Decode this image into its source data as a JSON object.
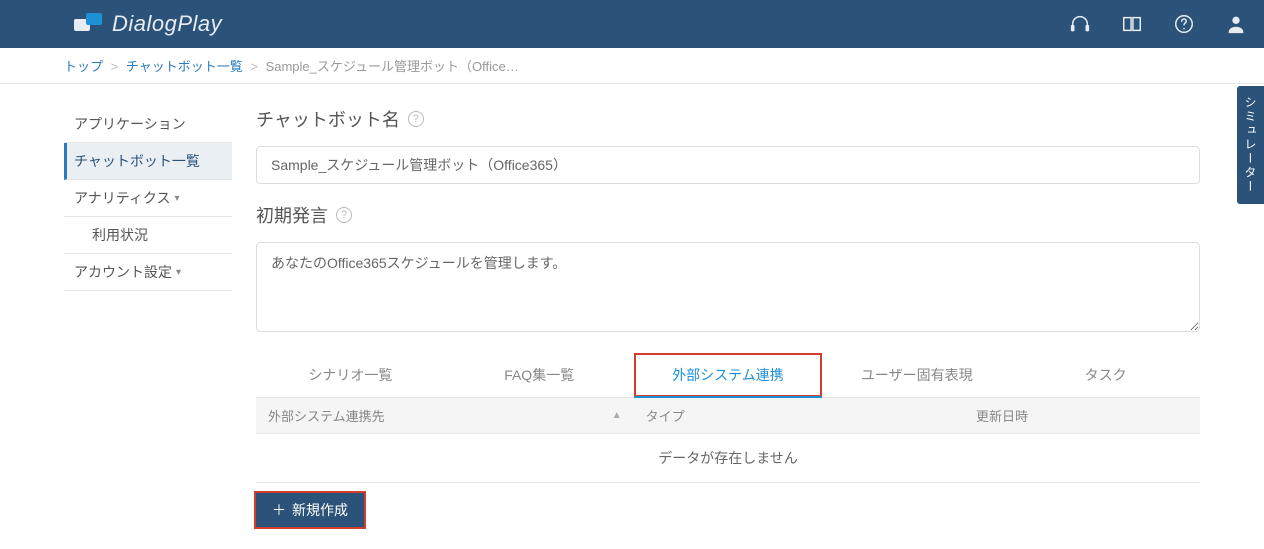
{
  "header": {
    "brand_name": "DialogPlay"
  },
  "breadcrumb": {
    "top": "トップ",
    "list": "チャットボット一覧",
    "current": "Sample_スケジュール管理ボット（Office…"
  },
  "sidebar": {
    "items": {
      "application": "アプリケーション",
      "chatbot_list": "チャットボット一覧",
      "analytics": "アナリティクス",
      "usage": "利用状況",
      "account": "アカウント設定"
    }
  },
  "main": {
    "name_label": "チャットボット名",
    "name_value": "Sample_スケジュール管理ボット（Office365）",
    "initial_label": "初期発言",
    "initial_value": "あなたのOffice365スケジュールを管理します。"
  },
  "tabs": {
    "scenario": "シナリオ一覧",
    "faq": "FAQ集一覧",
    "external": "外部システム連携",
    "user_expr": "ユーザー固有表現",
    "task": "タスク"
  },
  "table": {
    "col_dest": "外部システム連携先",
    "col_type": "タイプ",
    "col_updated": "更新日時",
    "empty": "データが存在しません"
  },
  "buttons": {
    "new": "新規作成"
  },
  "simulator_tab": "シミュレーター"
}
